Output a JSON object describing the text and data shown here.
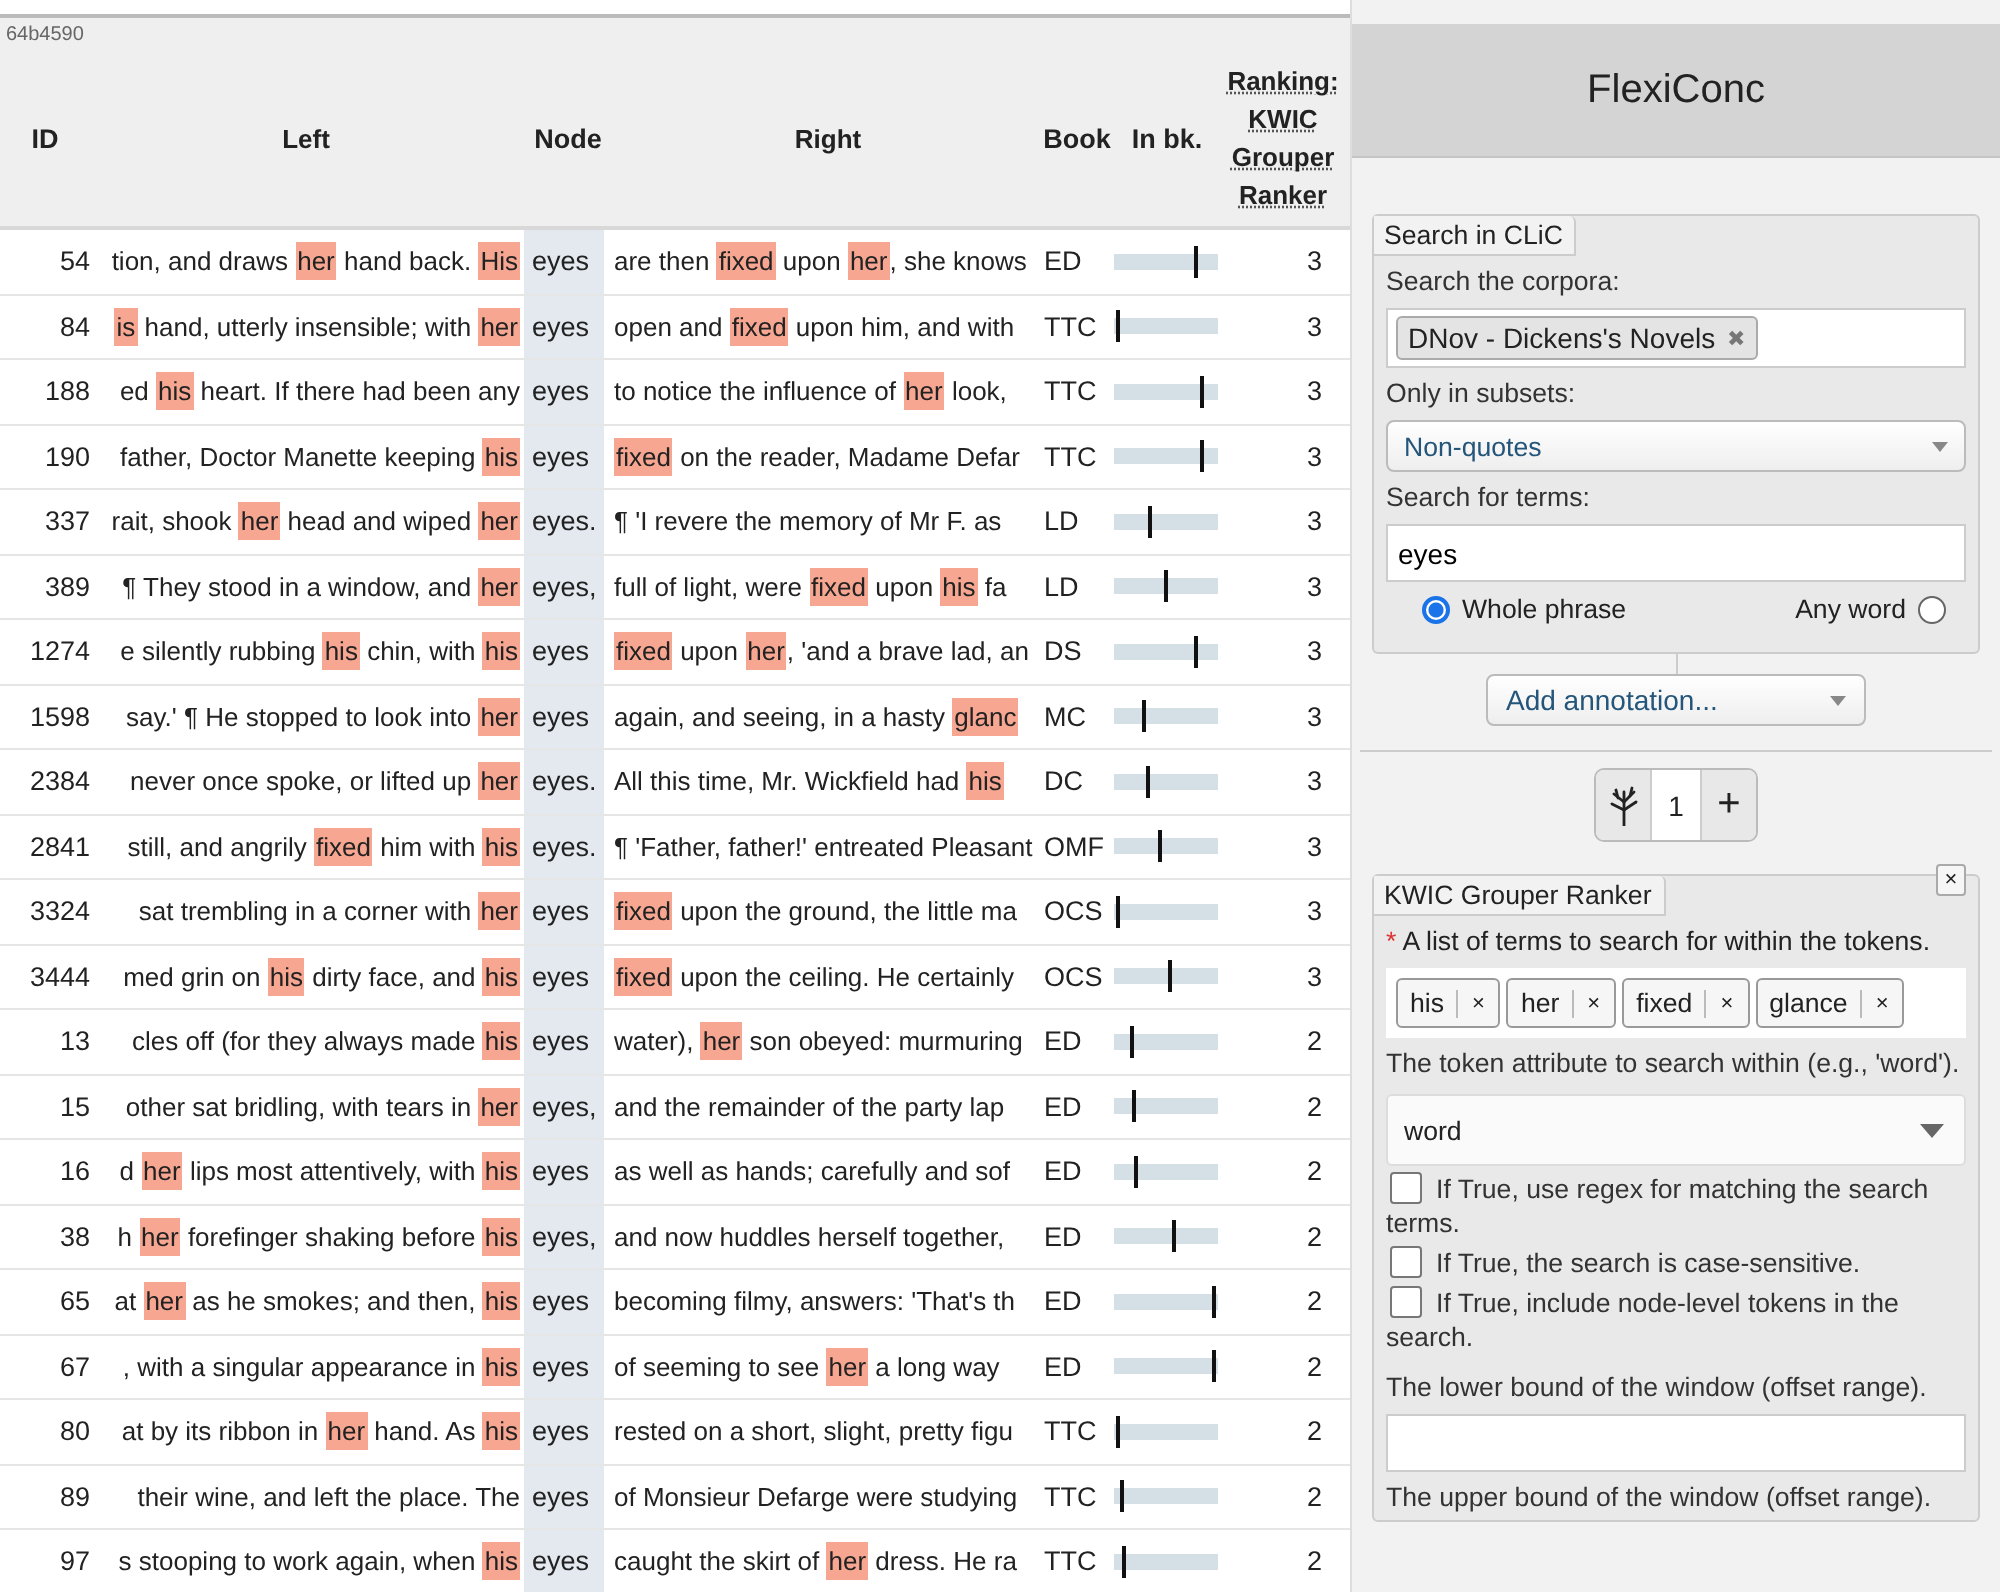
{
  "table": {
    "build": "64b4590",
    "columns": [
      "ID",
      "Left",
      "Node",
      "Right",
      "Book",
      "In bk.",
      "Ranking: KWIC Grouper Ranker"
    ],
    "rows": [
      {
        "id": "54",
        "left": [
          {
            "text": "tion, and draws ",
            "highlighted": false
          },
          {
            "text": "her",
            "highlighted": true
          },
          {
            "text": " hand back. ",
            "highlighted": false
          },
          {
            "text": "His",
            "highlighted": true
          }
        ],
        "node": "eyes",
        "right": [
          {
            "text": "are then ",
            "highlighted": false
          },
          {
            "text": "fixed",
            "highlighted": true
          },
          {
            "text": " upon ",
            "highlighted": false
          },
          {
            "text": "her",
            "highlighted": true
          },
          {
            "text": ", she knows",
            "highlighted": false
          }
        ],
        "book": "ED",
        "position": {
          "level": 0.78
        },
        "rank": "3"
      },
      {
        "id": "84",
        "left": [
          {
            "text": "is",
            "highlighted": true
          },
          {
            "text": " hand, utterly insensible; with ",
            "highlighted": false
          },
          {
            "text": "her",
            "highlighted": true
          }
        ],
        "node": "eyes",
        "right": [
          {
            "text": "open and ",
            "highlighted": false
          },
          {
            "text": "fixed",
            "highlighted": true
          },
          {
            "text": " upon him, and with",
            "highlighted": false
          }
        ],
        "book": "TTC",
        "position": {
          "level": 0.04
        },
        "rank": "3"
      },
      {
        "id": "188",
        "left": [
          {
            "text": "ed ",
            "highlighted": false
          },
          {
            "text": "his",
            "highlighted": true
          },
          {
            "text": " heart. If there had been any",
            "highlighted": false
          }
        ],
        "node": "eyes",
        "right": [
          {
            "text": "to notice the influence of ",
            "highlighted": false
          },
          {
            "text": "her",
            "highlighted": true
          },
          {
            "text": " look,",
            "highlighted": false
          }
        ],
        "book": "TTC",
        "position": {
          "level": 0.84
        },
        "rank": "3"
      },
      {
        "id": "190",
        "left": [
          {
            "text": "father, Doctor Manette keeping ",
            "highlighted": false
          },
          {
            "text": "his",
            "highlighted": true
          }
        ],
        "node": "eyes",
        "right": [
          {
            "text": "fixed",
            "highlighted": true
          },
          {
            "text": " on the reader, Madame Defar",
            "highlighted": false
          }
        ],
        "book": "TTC",
        "position": {
          "level": 0.84
        },
        "rank": "3"
      },
      {
        "id": "337",
        "left": [
          {
            "text": "rait, shook ",
            "highlighted": false
          },
          {
            "text": "her",
            "highlighted": true
          },
          {
            "text": " head and wiped ",
            "highlighted": false
          },
          {
            "text": "her",
            "highlighted": true
          }
        ],
        "node": "eyes.",
        "right": [
          {
            "text": "¶ 'I revere the memory of Mr F. as",
            "highlighted": false
          }
        ],
        "book": "LD",
        "position": {
          "level": 0.34
        },
        "rank": "3"
      },
      {
        "id": "389",
        "left": [
          {
            "text": "¶ They stood in a window, and ",
            "highlighted": false
          },
          {
            "text": "her",
            "highlighted": true
          }
        ],
        "node": "eyes,",
        "right": [
          {
            "text": "full of light, were ",
            "highlighted": false
          },
          {
            "text": "fixed",
            "highlighted": true
          },
          {
            "text": " upon ",
            "highlighted": false
          },
          {
            "text": "his",
            "highlighted": true
          },
          {
            "text": " fa",
            "highlighted": false
          }
        ],
        "book": "LD",
        "position": {
          "level": 0.5
        },
        "rank": "3"
      },
      {
        "id": "1274",
        "left": [
          {
            "text": "e silently rubbing ",
            "highlighted": false
          },
          {
            "text": "his",
            "highlighted": true
          },
          {
            "text": " chin, with ",
            "highlighted": false
          },
          {
            "text": "his",
            "highlighted": true
          }
        ],
        "node": "eyes",
        "right": [
          {
            "text": "fixed",
            "highlighted": true
          },
          {
            "text": " upon ",
            "highlighted": false
          },
          {
            "text": "her",
            "highlighted": true
          },
          {
            "text": ", 'and a brave lad, an",
            "highlighted": false
          }
        ],
        "book": "DS",
        "position": {
          "level": 0.78
        },
        "rank": "3"
      },
      {
        "id": "1598",
        "left": [
          {
            "text": "say.' ¶ He stopped to look into ",
            "highlighted": false
          },
          {
            "text": "her",
            "highlighted": true
          }
        ],
        "node": "eyes",
        "right": [
          {
            "text": "again, and seeing, in a hasty ",
            "highlighted": false
          },
          {
            "text": "glanc",
            "highlighted": true
          }
        ],
        "book": "MC",
        "position": {
          "level": 0.28
        },
        "rank": "3"
      },
      {
        "id": "2384",
        "left": [
          {
            "text": "never once spoke, or lifted up ",
            "highlighted": false
          },
          {
            "text": "her",
            "highlighted": true
          }
        ],
        "node": "eyes.",
        "right": [
          {
            "text": "All this time, Mr. Wickfield had ",
            "highlighted": false
          },
          {
            "text": "his",
            "highlighted": true
          }
        ],
        "book": "DC",
        "position": {
          "level": 0.32
        },
        "rank": "3"
      },
      {
        "id": "2841",
        "left": [
          {
            "text": "still, and angrily ",
            "highlighted": false
          },
          {
            "text": "fixed",
            "highlighted": true
          },
          {
            "text": " him with ",
            "highlighted": false
          },
          {
            "text": "his",
            "highlighted": true
          }
        ],
        "node": "eyes.",
        "right": [
          {
            "text": "¶ 'Father, father!' entreated Pleasant",
            "highlighted": false
          }
        ],
        "book": "OMF",
        "position": {
          "level": 0.44
        },
        "rank": "3"
      },
      {
        "id": "3324",
        "left": [
          {
            "text": "sat trembling in a corner with ",
            "highlighted": false
          },
          {
            "text": "her",
            "highlighted": true
          }
        ],
        "node": "eyes",
        "right": [
          {
            "text": "fixed",
            "highlighted": true
          },
          {
            "text": " upon the ground, the little ma",
            "highlighted": false
          }
        ],
        "book": "OCS",
        "position": {
          "level": 0.04
        },
        "rank": "3"
      },
      {
        "id": "3444",
        "left": [
          {
            "text": "med grin on ",
            "highlighted": false
          },
          {
            "text": "his",
            "highlighted": true
          },
          {
            "text": " dirty face, and ",
            "highlighted": false
          },
          {
            "text": "his",
            "highlighted": true
          }
        ],
        "node": "eyes",
        "right": [
          {
            "text": "fixed",
            "highlighted": true
          },
          {
            "text": " upon the ceiling. He certainly",
            "highlighted": false
          }
        ],
        "book": "OCS",
        "position": {
          "level": 0.54
        },
        "rank": "3"
      },
      {
        "id": "13",
        "left": [
          {
            "text": "cles off (for they always made ",
            "highlighted": false
          },
          {
            "text": "his",
            "highlighted": true
          }
        ],
        "node": "eyes",
        "right": [
          {
            "text": "water), ",
            "highlighted": false
          },
          {
            "text": "her",
            "highlighted": true
          },
          {
            "text": " son obeyed: murmuring",
            "highlighted": false
          }
        ],
        "book": "ED",
        "position": {
          "level": 0.18
        },
        "rank": "2"
      },
      {
        "id": "15",
        "left": [
          {
            "text": "other sat bridling, with tears in ",
            "highlighted": false
          },
          {
            "text": "her",
            "highlighted": true
          }
        ],
        "node": "eyes,",
        "right": [
          {
            "text": "and the remainder of the party lap",
            "highlighted": false
          }
        ],
        "book": "ED",
        "position": {
          "level": 0.2
        },
        "rank": "2"
      },
      {
        "id": "16",
        "left": [
          {
            "text": "d ",
            "highlighted": false
          },
          {
            "text": "her",
            "highlighted": true
          },
          {
            "text": " lips most attentively, with ",
            "highlighted": false
          },
          {
            "text": "his",
            "highlighted": true
          }
        ],
        "node": "eyes",
        "right": [
          {
            "text": "as well as hands; carefully and sof",
            "highlighted": false
          }
        ],
        "book": "ED",
        "position": {
          "level": 0.22
        },
        "rank": "2"
      },
      {
        "id": "38",
        "left": [
          {
            "text": "h ",
            "highlighted": false
          },
          {
            "text": "her",
            "highlighted": true
          },
          {
            "text": " forefinger shaking before ",
            "highlighted": false
          },
          {
            "text": "his",
            "highlighted": true
          }
        ],
        "node": "eyes,",
        "right": [
          {
            "text": "and now huddles herself together,",
            "highlighted": false
          }
        ],
        "book": "ED",
        "position": {
          "level": 0.58
        },
        "rank": "2"
      },
      {
        "id": "65",
        "left": [
          {
            "text": "at ",
            "highlighted": false
          },
          {
            "text": "her",
            "highlighted": true
          },
          {
            "text": " as he smokes; and then, ",
            "highlighted": false
          },
          {
            "text": "his",
            "highlighted": true
          }
        ],
        "node": "eyes",
        "right": [
          {
            "text": "becoming filmy, answers: 'That's th",
            "highlighted": false
          }
        ],
        "book": "ED",
        "position": {
          "level": 0.96
        },
        "rank": "2"
      },
      {
        "id": "67",
        "left": [
          {
            "text": ", with a singular appearance in ",
            "highlighted": false
          },
          {
            "text": "his",
            "highlighted": true
          }
        ],
        "node": "eyes",
        "right": [
          {
            "text": "of seeming to see ",
            "highlighted": false
          },
          {
            "text": "her",
            "highlighted": true
          },
          {
            "text": " a long way",
            "highlighted": false
          }
        ],
        "book": "ED",
        "position": {
          "level": 0.96
        },
        "rank": "2"
      },
      {
        "id": "80",
        "left": [
          {
            "text": "at by its ribbon in ",
            "highlighted": false
          },
          {
            "text": "her",
            "highlighted": true
          },
          {
            "text": " hand. As ",
            "highlighted": false
          },
          {
            "text": "his",
            "highlighted": true
          }
        ],
        "node": "eyes",
        "right": [
          {
            "text": "rested on a short, slight, pretty figu",
            "highlighted": false
          }
        ],
        "book": "TTC",
        "position": {
          "level": 0.04
        },
        "rank": "2"
      },
      {
        "id": "89",
        "left": [
          {
            "text": "their wine, and left the place. The",
            "highlighted": false
          }
        ],
        "node": "eyes",
        "right": [
          {
            "text": "of Monsieur Defarge were studying",
            "highlighted": false
          }
        ],
        "book": "TTC",
        "position": {
          "level": 0.08
        },
        "rank": "2"
      },
      {
        "id": "97",
        "left": [
          {
            "text": "s stooping to work again, when ",
            "highlighted": false
          },
          {
            "text": "his",
            "highlighted": true
          }
        ],
        "node": "eyes",
        "right": [
          {
            "text": "caught the skirt of ",
            "highlighted": false
          },
          {
            "text": "her",
            "highlighted": true
          },
          {
            "text": " dress. He ra",
            "highlighted": false
          }
        ],
        "book": "TTC",
        "position": {
          "level": 0.1
        },
        "rank": "2"
      }
    ]
  },
  "panel": {
    "title": "FlexiConc",
    "search": {
      "legend": "Search in CLiC",
      "corpora_label": "Search the corpora:",
      "corpora": [
        {
          "label": "DNov - Dickens's Novels",
          "remove": "✖"
        }
      ],
      "subsets_label": "Only in subsets:",
      "subset": "Non-quotes",
      "terms_label": "Search for terms:",
      "terms": "eyes",
      "modes": [
        {
          "label": "Whole phrase",
          "selected": true
        },
        {
          "label": "Any word",
          "selected": false
        }
      ]
    },
    "annotation": "Add annotation...",
    "stepper": {
      "value": "1",
      "add": "+"
    },
    "ranker": {
      "legend": "KWIC Grouper Ranker",
      "close": "×",
      "fields": [
        {
          "kind": "tags",
          "required_mark": "*",
          "label": "A list of terms to search for within the tokens.",
          "tags": [
            {
              "label": "his",
              "remove": "×"
            },
            {
              "label": "her",
              "remove": "×"
            },
            {
              "label": "fixed",
              "remove": "×"
            },
            {
              "label": "glance",
              "remove": "×"
            }
          ]
        },
        {
          "kind": "select",
          "label": "The token attribute to search within (e.g., 'word').",
          "value": "word"
        },
        {
          "kind": "checkbox",
          "label": "If True, use regex for matching the search terms.",
          "checked": false
        },
        {
          "kind": "checkbox",
          "label": "If True, the search is case-sensitive.",
          "checked": false
        },
        {
          "kind": "checkbox",
          "label": "If True, include node-level tokens in the search.",
          "checked": false
        },
        {
          "kind": "input",
          "label": "The lower bound of the window (offset range)."
        },
        {
          "kind": "label",
          "label": "The upper bound of the window (offset range)."
        }
      ]
    }
  }
}
